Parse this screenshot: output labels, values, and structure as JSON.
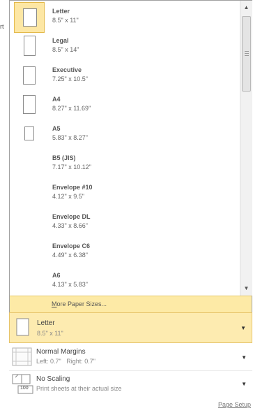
{
  "left_cut_text": "rt",
  "paper_sizes": [
    {
      "name": "Letter",
      "dims": "8.5\" x 11\"",
      "selected": true
    },
    {
      "name": "Legal",
      "dims": "8.5\" x 14\""
    },
    {
      "name": "Executive",
      "dims": "7.25\" x 10.5\""
    },
    {
      "name": "A4",
      "dims": "8.27\" x 11.69\""
    },
    {
      "name": "A5",
      "dims": "5.83\" x 8.27\""
    },
    {
      "name": "B5 (JIS)",
      "dims": "7.17\" x 10.12\""
    },
    {
      "name": "Envelope #10",
      "dims": "4.12\" x 9.5\""
    },
    {
      "name": "Envelope DL",
      "dims": "4.33\" x 8.66\""
    },
    {
      "name": "Envelope C6",
      "dims": "4.49\" x 6.38\""
    },
    {
      "name": "A6",
      "dims": "4.13\" x 5.83\""
    }
  ],
  "more_sizes": {
    "accel": "M",
    "rest": "ore Paper Sizes..."
  },
  "size_control": {
    "title": "Letter",
    "subtitle": "8.5\" x 11\""
  },
  "margins_control": {
    "title": "Normal Margins",
    "left": "Left: 0.7\"",
    "right": "Right: 0.7\""
  },
  "scaling_control": {
    "title": "No Scaling",
    "subtitle": "Print sheets at their actual size",
    "icon_text": "100"
  },
  "page_setup_link": "Page Setup",
  "colors": {
    "highlight": "#fdebb0",
    "highlight_border": "#e6c36a"
  },
  "icons": {
    "scroll_up": "chevron-up-icon",
    "scroll_down": "chevron-down-icon",
    "dropdown": "dropdown-arrow-icon"
  }
}
